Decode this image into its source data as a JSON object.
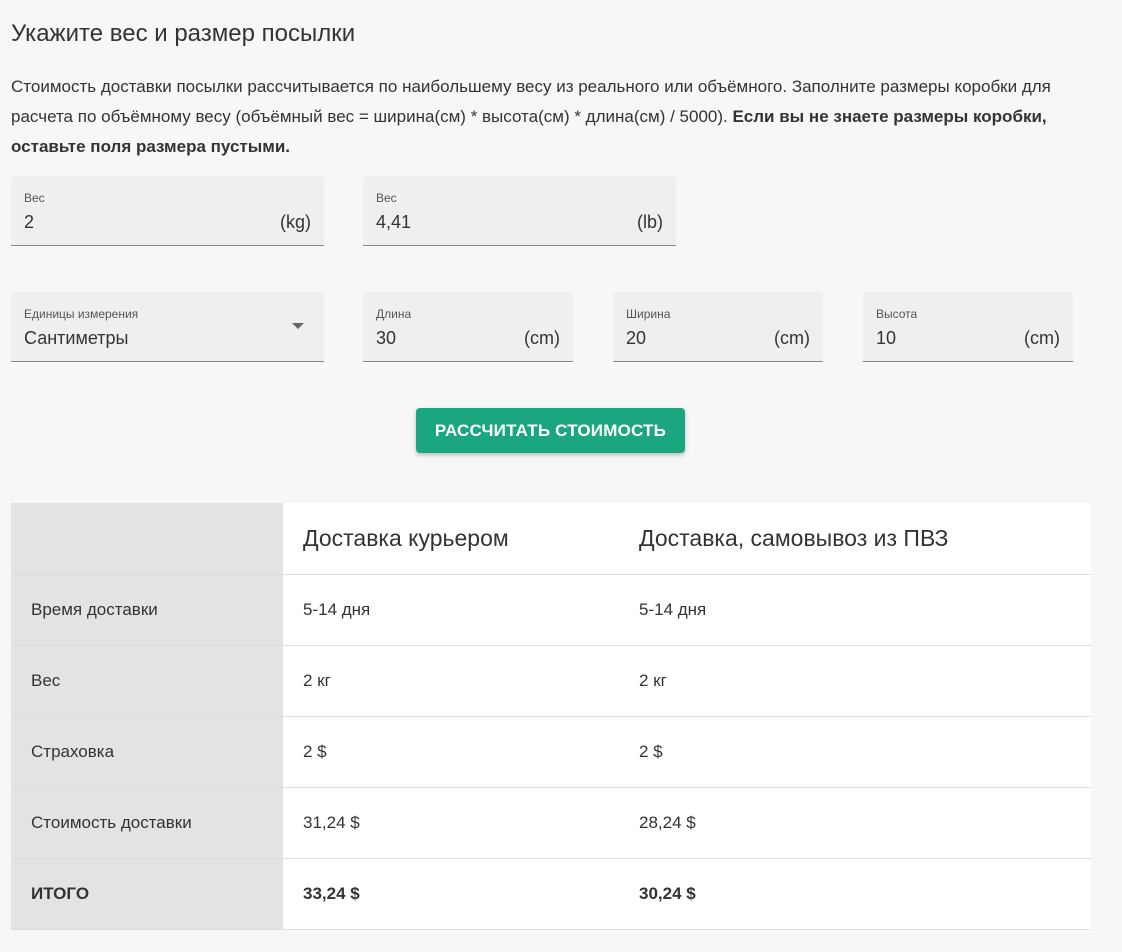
{
  "header": {
    "title": "Укажите вес и размер посылки",
    "description": "Стоимость доставки посылки рассчитывается по наибольшему весу из реального или объёмного. Заполните размеры коробки для расчета по объёмному весу (объёмный вес = ширина(см) * высота(см) * длина(см) / 5000).",
    "description_bold": "Если вы не знаете размеры коробки, оставьте поля размера пустыми."
  },
  "weight_kg": {
    "label": "Вес",
    "value": "2",
    "unit": "(kg)"
  },
  "weight_lb": {
    "label": "Вес",
    "value": "4,41",
    "unit": "(lb)"
  },
  "units_select": {
    "label": "Единицы измерения",
    "value": "Сантиметры"
  },
  "length": {
    "label": "Длина",
    "value": "30",
    "unit": "(cm)"
  },
  "width": {
    "label": "Ширина",
    "value": "20",
    "unit": "(cm)"
  },
  "height": {
    "label": "Высота",
    "value": "10",
    "unit": "(cm)"
  },
  "calc_button": {
    "label": "РАССЧИТАТЬ СТОИМОСТЬ"
  },
  "colors": {
    "accent": "#1aa67e",
    "row_header_bg": "#e3e3e3",
    "page_bg": "#f7f7f7"
  },
  "icons": {
    "select_caret": "caret-down-icon"
  },
  "results": {
    "columns": [
      "Доставка курьером",
      "Доставка, самовывоз из ПВЗ"
    ],
    "rows": [
      {
        "label": "Время доставки",
        "values": [
          "5-14 дня",
          "5-14 дня"
        ]
      },
      {
        "label": "Вес",
        "values": [
          "2 кг",
          "2 кг"
        ]
      },
      {
        "label": "Страховка",
        "values": [
          "2 $",
          "2 $"
        ]
      },
      {
        "label": "Стоимость доставки",
        "values": [
          "31,24 $",
          "28,24 $"
        ]
      },
      {
        "label": "ИТОГО",
        "values": [
          "33,24 $",
          "30,24 $"
        ]
      }
    ]
  }
}
